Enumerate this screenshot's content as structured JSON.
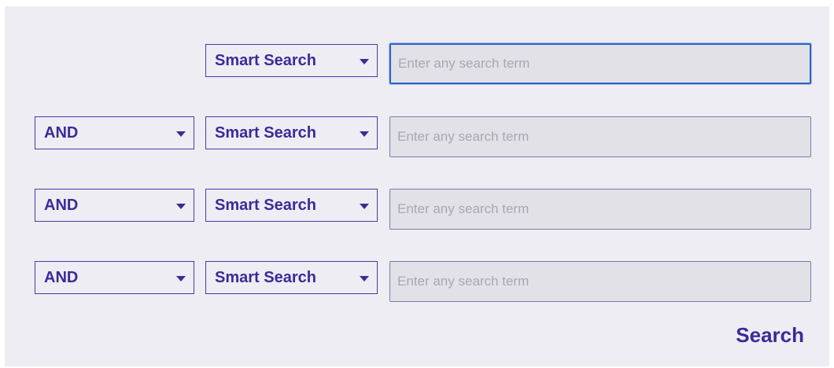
{
  "rows": [
    {
      "boolean": null,
      "field": "Smart Search",
      "placeholder": "Enter any search term",
      "value": ""
    },
    {
      "boolean": "AND",
      "field": "Smart Search",
      "placeholder": "Enter any search term",
      "value": ""
    },
    {
      "boolean": "AND",
      "field": "Smart Search",
      "placeholder": "Enter any search term",
      "value": ""
    },
    {
      "boolean": "AND",
      "field": "Smart Search",
      "placeholder": "Enter any search term",
      "value": ""
    }
  ],
  "icons": {
    "dropdown": "caret-down-icon"
  },
  "search_label": "Search",
  "colors": {
    "accent": "#3b2b99",
    "focus": "#2d63c8",
    "panel": "#eeedf3",
    "input_bg": "#e2e1e8"
  }
}
